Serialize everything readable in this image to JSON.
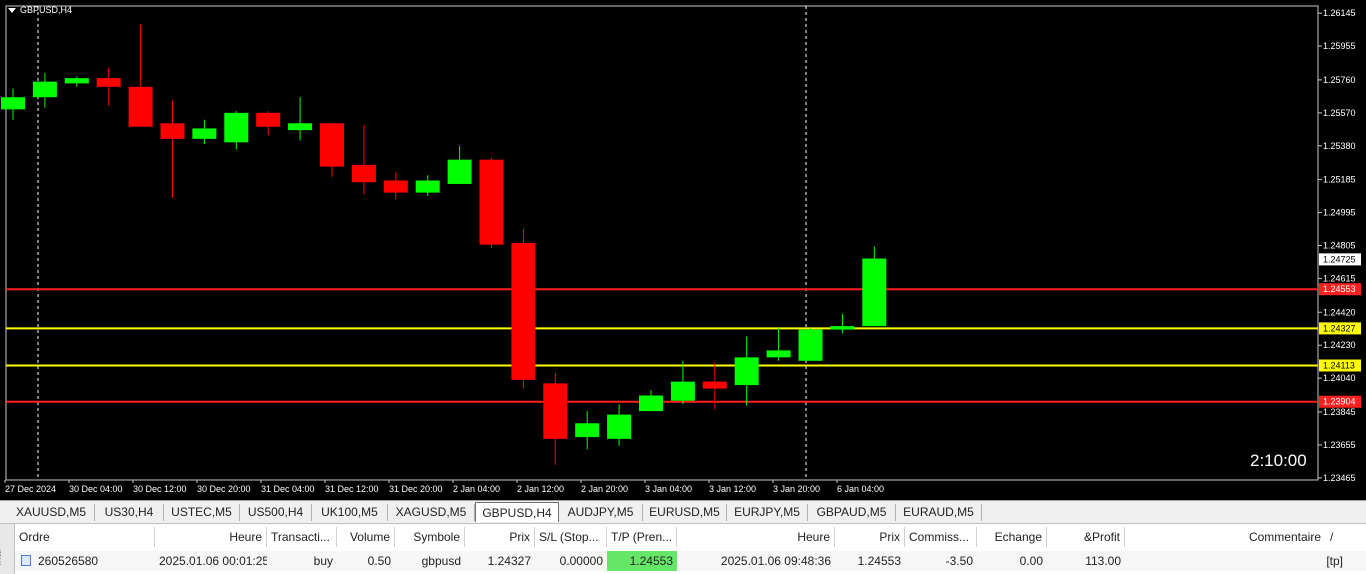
{
  "chart": {
    "symbol_title": "GBPUSD,H4",
    "countdown": "2:10:00",
    "colors": {
      "bull": "#00ff00",
      "bear": "#ff0000",
      "background": "#000000",
      "grid_line": "#ffffff"
    },
    "price_scale": {
      "top": 1.2614,
      "bottom": 1.2347
    },
    "price_labels": [
      "1.26145",
      "1.25955",
      "1.25760",
      "1.25570",
      "1.25380",
      "1.25185",
      "1.24995",
      "1.24805",
      "1.24615",
      "1.24420",
      "1.24230",
      "1.24040",
      "1.23845",
      "1.23655",
      "1.23465"
    ],
    "time_labels": [
      "27 Dec 2024",
      "30 Dec 04:00",
      "30 Dec 12:00",
      "30 Dec 20:00",
      "31 Dec 04:00",
      "31 Dec 12:00",
      "31 Dec 20:00",
      "2 Jan 04:00",
      "2 Jan 12:00",
      "2 Jan 20:00",
      "3 Jan 04:00",
      "3 Jan 12:00",
      "3 Jan 20:00",
      "6 Jan 04:00"
    ],
    "current_price_label": "1.24725",
    "levels": [
      {
        "price": 1.24553,
        "label": "1.24553",
        "color": "#ff2020",
        "label_bg": "#ff2020",
        "label_color": "#ffffff"
      },
      {
        "price": 1.24327,
        "label": "1.24327",
        "color": "#ffff00",
        "label_bg": "#ffff00",
        "label_color": "#000000"
      },
      {
        "price": 1.24113,
        "label": "1.24113",
        "color": "#ffff00",
        "label_bg": "#ffff00",
        "label_color": "#000000"
      },
      {
        "price": 1.23904,
        "label": "1.23904",
        "color": "#ff2020",
        "label_bg": "#ff2020",
        "label_color": "#ffffff"
      }
    ],
    "candles": [
      {
        "o": 1.2559,
        "h": 1.2571,
        "l": 1.2553,
        "c": 1.2566
      },
      {
        "o": 1.2566,
        "h": 1.258,
        "l": 1.256,
        "c": 1.2575
      },
      {
        "o": 1.2574,
        "h": 1.2578,
        "l": 1.2572,
        "c": 1.2577
      },
      {
        "o": 1.2577,
        "h": 1.2583,
        "l": 1.2561,
        "c": 1.2572
      },
      {
        "o": 1.2572,
        "h": 1.2608,
        "l": 1.255,
        "c": 1.2549
      },
      {
        "o": 1.2551,
        "h": 1.2564,
        "l": 1.2508,
        "c": 1.2542
      },
      {
        "o": 1.2542,
        "h": 1.2553,
        "l": 1.2539,
        "c": 1.2548
      },
      {
        "o": 1.254,
        "h": 1.2558,
        "l": 1.2536,
        "c": 1.2557
      },
      {
        "o": 1.2557,
        "h": 1.2558,
        "l": 1.2544,
        "c": 1.2549
      },
      {
        "o": 1.2547,
        "h": 1.2566,
        "l": 1.2541,
        "c": 1.2551
      },
      {
        "o": 1.2551,
        "h": 1.2551,
        "l": 1.252,
        "c": 1.2526
      },
      {
        "o": 1.2527,
        "h": 1.255,
        "l": 1.251,
        "c": 1.2517
      },
      {
        "o": 1.2518,
        "h": 1.2523,
        "l": 1.2507,
        "c": 1.2511
      },
      {
        "o": 1.2511,
        "h": 1.2521,
        "l": 1.2509,
        "c": 1.2518
      },
      {
        "o": 1.2516,
        "h": 1.2538,
        "l": 1.2516,
        "c": 1.253
      },
      {
        "o": 1.253,
        "h": 1.2531,
        "l": 1.2479,
        "c": 1.2481
      },
      {
        "o": 1.2482,
        "h": 1.249,
        "l": 1.2398,
        "c": 1.2403
      },
      {
        "o": 1.2401,
        "h": 1.2407,
        "l": 1.2354,
        "c": 1.2369
      },
      {
        "o": 1.237,
        "h": 1.2385,
        "l": 1.2363,
        "c": 1.2378
      },
      {
        "o": 1.2369,
        "h": 1.2389,
        "l": 1.2365,
        "c": 1.2383
      },
      {
        "o": 1.2385,
        "h": 1.2397,
        "l": 1.2385,
        "c": 1.2394
      },
      {
        "o": 1.2391,
        "h": 1.2414,
        "l": 1.2389,
        "c": 1.2402
      },
      {
        "o": 1.2402,
        "h": 1.2413,
        "l": 1.2386,
        "c": 1.2398
      },
      {
        "o": 1.24,
        "h": 1.2428,
        "l": 1.2388,
        "c": 1.2416
      },
      {
        "o": 1.2416,
        "h": 1.2433,
        "l": 1.2414,
        "c": 1.242
      },
      {
        "o": 1.2414,
        "h": 1.2433,
        "l": 1.2414,
        "c": 1.2432
      },
      {
        "o": 1.2432,
        "h": 1.2441,
        "l": 1.243,
        "c": 1.2434
      },
      {
        "o": 1.2434,
        "h": 1.248,
        "l": 1.2434,
        "c": 1.2473
      }
    ]
  },
  "tabs": [
    "XAUUSD,M5",
    "US30,H4",
    "USTEC,M5",
    "US500,H4",
    "UK100,M5",
    "XAGUSD,M5",
    "GBPUSD,H4",
    "AUDJPY,M5",
    "EURUSD,M5",
    "EURJPY,M5",
    "GBPAUD,M5",
    "EURAUD,M5"
  ],
  "active_tab": "GBPUSD,H4",
  "terminal": {
    "side_label": "inal",
    "columns": [
      "Ordre",
      "Heure",
      "Transacti...",
      "Volume",
      "Symbole",
      "Prix",
      "S/L (Stop...",
      "T/P (Pren...",
      "Heure",
      "Prix",
      "Commiss...",
      "Echange",
      "&Profit",
      "Commentaire"
    ],
    "sort_indicator": "/",
    "row": {
      "order": "260526580",
      "time_open": "2025.01.06 00:01:25",
      "type": "buy",
      "volume": "0.50",
      "symbol": "gbpusd",
      "price_open": "1.24327",
      "sl": "0.00000",
      "tp": "1.24553",
      "time_close": "2025.01.06 09:48:36",
      "price_close": "1.24553",
      "commission": "-3.50",
      "swap": "0.00",
      "profit": "113.00",
      "comment": "[tp]"
    }
  }
}
